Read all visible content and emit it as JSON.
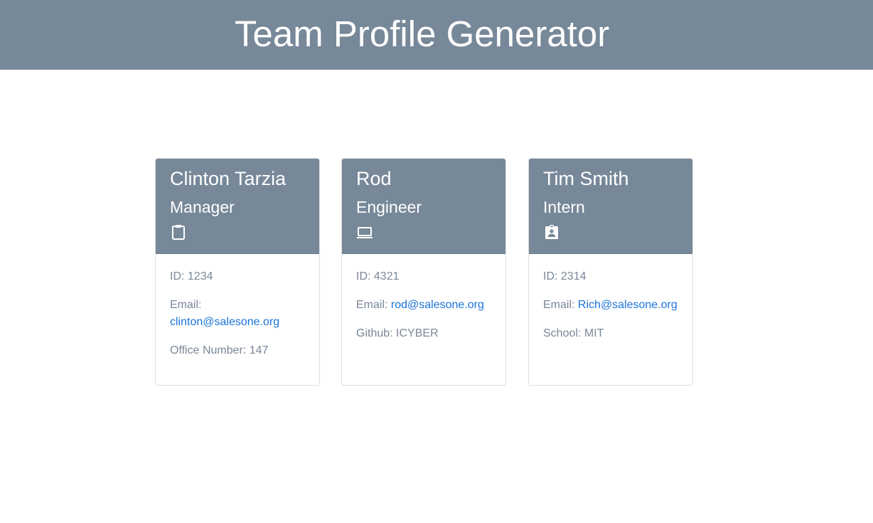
{
  "page": {
    "title": "Team Profile Generator"
  },
  "colors": {
    "header_bg": "#778899",
    "text_muted": "#7a8797",
    "link": "#1a73d9"
  },
  "cards": [
    {
      "name": "Clinton Tarzia",
      "role": "Manager",
      "icon": "clipboard-icon",
      "id_label": "ID:",
      "id_value": "1234",
      "email_label": "Email:",
      "email": "clinton@salesone.org",
      "extra_label": "Office Number:",
      "extra_value": "147"
    },
    {
      "name": "Rod",
      "role": "Engineer",
      "icon": "laptop-icon",
      "id_label": "ID:",
      "id_value": "4321",
      "email_label": "Email:",
      "email": "rod@salesone.org",
      "extra_label": "Github:",
      "extra_value": "ICYBER"
    },
    {
      "name": "Tim Smith",
      "role": "Intern",
      "icon": "id-badge-icon",
      "id_label": "ID:",
      "id_value": "2314",
      "email_label": "Email:",
      "email": "Rich@salesone.org",
      "extra_label": "School:",
      "extra_value": "MIT"
    }
  ]
}
